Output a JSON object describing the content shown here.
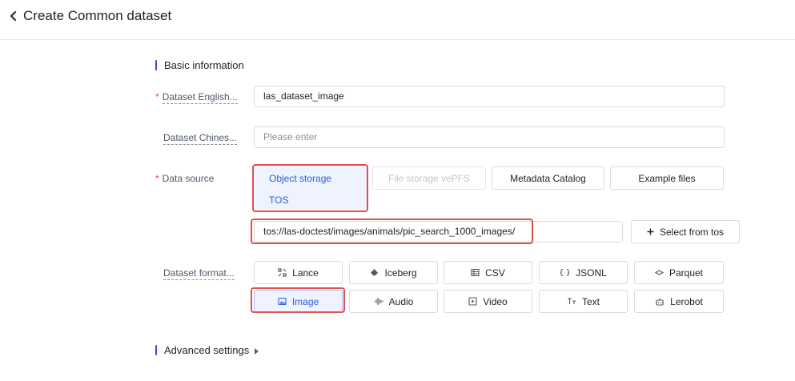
{
  "header": {
    "title": "Create Common dataset"
  },
  "basic_section": {
    "title": "Basic information"
  },
  "fields": {
    "english_name": {
      "label": "Dataset English...",
      "value": "las_dataset_image"
    },
    "chinese_name": {
      "label": "Dataset Chines...",
      "placeholder": "Please enter"
    },
    "data_source": {
      "label": "Data source",
      "selected_options": [
        "Object storage",
        "TOS"
      ],
      "options": [
        "File storage vePFS",
        "Metadata Catalog",
        "Example files"
      ],
      "path_value": "tos://las-doctest/images/animals/pic_search_1000_images/",
      "select_button": "Select from tos"
    },
    "format": {
      "label": "Dataset format...",
      "options": [
        "Lance",
        "Iceberg",
        "CSV",
        "JSONL",
        "Parquet",
        "Image",
        "Audio",
        "Video",
        "Text",
        "Lerobot"
      ],
      "selected": "Image"
    }
  },
  "advanced_section": {
    "title": "Advanced settings"
  },
  "colors": {
    "accent": "#2a5fe0",
    "highlight": "#e34f4a",
    "required": "#e5484d",
    "section_bar": "#3b47e0"
  }
}
